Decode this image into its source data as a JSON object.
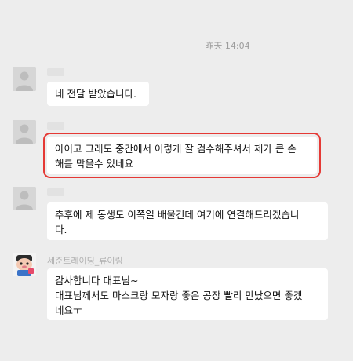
{
  "timestamp": "昨天 14:04",
  "messages": [
    {
      "sender_name": "",
      "sender_blurred": true,
      "lines": [
        "네 전달 받았습니다."
      ],
      "highlighted": false
    },
    {
      "sender_name": "",
      "sender_blurred": true,
      "lines": [
        "아이고 그래도 중간에서 이렇게 잘 검수해주셔서 제가 큰 손",
        "해를 막을수 있네요"
      ],
      "highlighted": true
    },
    {
      "sender_name": "",
      "sender_blurred": true,
      "lines": [
        "추후에 제 동생도 이쪽일 배울건데 여기에 연결해드리겠습니",
        "다."
      ],
      "highlighted": false
    },
    {
      "sender_name": "세준트레이딩_류이림",
      "sender_blurred": false,
      "lines": [
        "감사합니다 대표님~",
        "대표님께서도 마스크랑 모자랑 좋은 공장 빨리 만났으면 좋겠",
        "네요ㅜ"
      ],
      "highlighted": false
    }
  ],
  "colors": {
    "background": "#ededed",
    "bubble": "#ffffff",
    "highlight": "#e53935"
  }
}
